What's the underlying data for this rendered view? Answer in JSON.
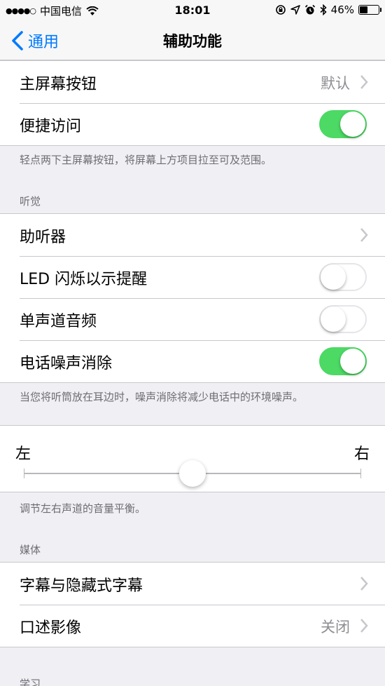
{
  "status_bar": {
    "signal": "●●●●○",
    "carrier": "中国电信",
    "time": "18:01",
    "battery_text": "46%",
    "battery_level": 0.46
  },
  "nav": {
    "back_label": "通用",
    "title": "辅助功能"
  },
  "group1": {
    "home_button_label": "主屏幕按钮",
    "home_button_value": "默认",
    "reachability_label": "便捷访问",
    "reachability_on": true,
    "footer": "轻点两下主屏幕按钮，将屏幕上方项目拉至可及范围。"
  },
  "hearing": {
    "header": "听觉",
    "hearing_aids_label": "助听器",
    "led_flash_label": "LED 闪烁以示提醒",
    "led_flash_on": false,
    "mono_audio_label": "单声道音频",
    "mono_audio_on": false,
    "noise_cancel_label": "电话噪声消除",
    "noise_cancel_on": true,
    "footer": "当您将听筒放在耳边时，噪声消除将减少电话中的环境噪声。"
  },
  "balance": {
    "left_label": "左",
    "right_label": "右",
    "value": 0.5,
    "footer": "调节左右声道的音量平衡。"
  },
  "media": {
    "header": "媒体",
    "subtitles_label": "字幕与隐藏式字幕",
    "audio_desc_label": "口述影像",
    "audio_desc_value": "关闭"
  },
  "learning": {
    "header": "学习"
  },
  "colors": {
    "accent": "#007aff",
    "toggle_on": "#4cd964"
  }
}
